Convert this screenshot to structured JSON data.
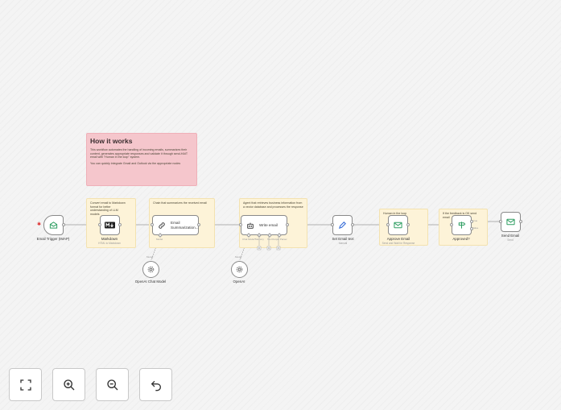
{
  "sticky_how": {
    "title": "How it works",
    "body": "This workflow automates the handling of incoming emails, summarizes their content, generates appropriate responses and validate it through send-HAIT email with \"Human in the loop\" system.",
    "footer": "You can quickly integrate Gmail and Outlook via the appropriate nodes"
  },
  "sticky_markdown": {
    "text": "Convert email to Markdown format for better understanding of LLM models"
  },
  "sticky_summary": {
    "text": "Chain that summarizes the received email"
  },
  "sticky_agent": {
    "text": "Agent that retrieves business information from a vector database and processes the response"
  },
  "sticky_human": {
    "text": "Human in the loop"
  },
  "sticky_feedback": {
    "text": "If the feedback is OK send email"
  },
  "nodes": {
    "trigger": {
      "label": "Email Trigger (IMAP)",
      "icon": "envelope-open-icon"
    },
    "markdown": {
      "label": "Markdown",
      "sub": "HTML to Markdown",
      "icon": "markdown-icon"
    },
    "summarization": {
      "text": "Email Summarization...",
      "icon": "link-icon"
    },
    "write_email": {
      "text": "Write email",
      "icon": "robot-icon"
    },
    "set_email": {
      "label": "Set Email text",
      "sub": "manual",
      "icon": "pencil-icon"
    },
    "approve_email": {
      "label": "Approve Email",
      "sub": "Send and Wait for Response",
      "icon": "envelope-icon"
    },
    "approved": {
      "label": "Approved?",
      "icon": "signpost-icon"
    },
    "send_email": {
      "label": "Send Email",
      "sub": "Send",
      "icon": "envelope-icon"
    },
    "openai_chat": {
      "label": "OpenAI Chat Model",
      "icon": "openai-icon"
    },
    "openai": {
      "label": "OpenAI",
      "icon": "openai-icon"
    }
  },
  "ports": {
    "model": "Model",
    "chat_model": "Chat Model*",
    "memory": "Memory",
    "tool": "Tool",
    "output_parser": "Output Parser",
    "true": "true",
    "false": "false"
  },
  "toolbar": {
    "fit_view": "fit-view-icon",
    "zoom_in": "zoom-in-icon",
    "zoom_out": "zoom-out-icon",
    "undo": "undo-icon"
  },
  "colors": {
    "sticky_yellow": "#fdf3d8",
    "sticky_pink": "#f5c6cc",
    "node_icon_green": "#2f9e62",
    "accent_red": "#d33333"
  }
}
